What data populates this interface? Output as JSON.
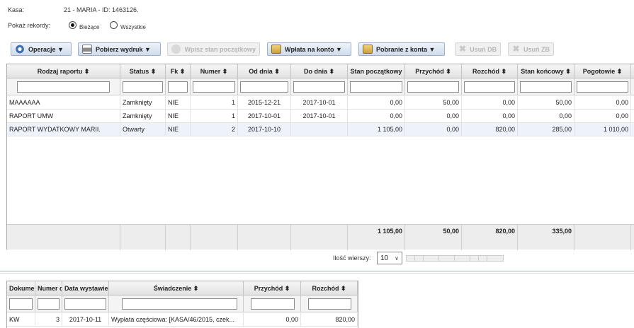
{
  "kasa": {
    "label": "Kasa:",
    "value": "21 - MARIA - ID: 1463126."
  },
  "records": {
    "label": "Pokaż rekordy:",
    "current_label": "Bieżące",
    "all_label": "Wszystkie"
  },
  "toolbar": {
    "operations": "Operacje ▼",
    "print": "Pobierz wydruk ▼",
    "initial_state": "Wpisz stan początkowy",
    "deposit": "Wpłata na konto ▼",
    "withdraw": "Pobranie z konta ▼",
    "delete_db": "Usuń DB",
    "delete_zb": "Usuń ZB"
  },
  "main_table": {
    "headers": [
      "Rodzaj raportu ⬍",
      "Status ⬍",
      "Fk ⬍",
      "Numer ⬍",
      "Od dnia ⬍",
      "Do dnia ⬍",
      "Stan początkowy",
      "Przychód ⬍",
      "Rozchód ⬍",
      "Stan końcowy ⬍",
      "Pogotowie ⬍"
    ],
    "rows": [
      [
        "MAAAAAA",
        "Zamknięty",
        "NIE",
        "1",
        "2015-12-21",
        "2017-10-01",
        "0,00",
        "50,00",
        "0,00",
        "50,00",
        "0,00"
      ],
      [
        "RAPORT UMW",
        "Zamknięty",
        "NIE",
        "1",
        "2017-10-01",
        "2017-10-01",
        "0,00",
        "0,00",
        "0,00",
        "0,00",
        "0,00"
      ],
      [
        "RAPORT WYDATKOWY MARII.",
        "Otwarty",
        "NIE",
        "2",
        "2017-10-10",
        "",
        "1 105,00",
        "0,00",
        "820,00",
        "285,00",
        "1 010,00"
      ]
    ],
    "footer": [
      "",
      "",
      "",
      "",
      "",
      "",
      "1 105,00",
      "50,00",
      "820,00",
      "335,00",
      ""
    ]
  },
  "pager": {
    "label": "Ilość wierszy:",
    "rows_value": "10"
  },
  "detail_table": {
    "headers": [
      "Dokume",
      "Numer d",
      "Data wystawie",
      "Świadczenie ⬍",
      "Przychód ⬍",
      "Rozchód ⬍"
    ],
    "rows": [
      [
        "KW",
        "3",
        "2017-10-11",
        "Wypłata częściowa: [KASA/46/2015, czek...",
        "0,00",
        "820,00"
      ]
    ]
  },
  "colors": {
    "button_border": "#9fb0c6",
    "header_bg": "#e2e2e2",
    "selected_row": "#eef3fb"
  },
  "icons": [
    "gear-icon",
    "printer-icon",
    "initial-state-icon",
    "deposit-icon",
    "withdraw-icon",
    "delete-icon",
    "chevron-down-icon"
  ]
}
